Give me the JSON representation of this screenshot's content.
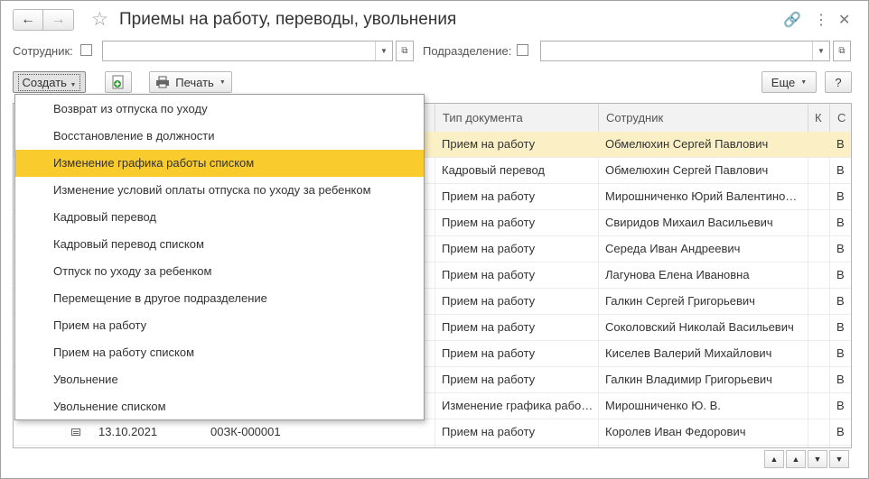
{
  "window": {
    "title": "Приемы на работу, переводы, увольнения",
    "back_icon": "arrow-left-icon",
    "forward_icon": "arrow-right-icon",
    "favorite_icon": "star-icon",
    "link_icon": "link-icon",
    "more_icon": "kebab-icon",
    "close_icon": "close-icon"
  },
  "filters": {
    "employee_label": "Сотрудник:",
    "employee_value": "",
    "department_label": "Подразделение:",
    "department_value": ""
  },
  "toolbar": {
    "create_label": "Создать",
    "print_label": "Печать",
    "more_label": "Еще",
    "help_label": "?"
  },
  "table": {
    "columns": [
      "Тип документа",
      "Сотрудник",
      "К",
      "С"
    ],
    "rows": [
      {
        "date": "",
        "number": "",
        "type": "Прием на работу",
        "employee": "Обмелюхин Сергей Павлович",
        "c": "В",
        "selected": true
      },
      {
        "date": "",
        "number": "",
        "type": "Кадровый перевод",
        "employee": "Обмелюхин Сергей Павлович",
        "c": "В"
      },
      {
        "date": "",
        "number": "",
        "type": "Прием на работу",
        "employee": "Мирошниченко Юрий Валентино…",
        "c": "В"
      },
      {
        "date": "",
        "number": "",
        "type": "Прием на работу",
        "employee": "Свиридов Михаил Васильевич",
        "c": "В"
      },
      {
        "date": "",
        "number": "",
        "type": "Прием на работу",
        "employee": "Середа Иван Андреевич",
        "c": "В"
      },
      {
        "date": "",
        "number": "",
        "type": "Прием на работу",
        "employee": "Лагунова Елена Ивановна",
        "c": "В"
      },
      {
        "date": "",
        "number": "",
        "type": "Прием на работу",
        "employee": "Галкин Сергей Григорьевич",
        "c": "В"
      },
      {
        "date": "",
        "number": "",
        "type": "Прием на работу",
        "employee": "Соколовский Николай Васильевич",
        "c": "В"
      },
      {
        "date": "",
        "number": "",
        "type": "Прием на работу",
        "employee": "Киселев Валерий Михайлович",
        "c": "В"
      },
      {
        "date": "",
        "number": "",
        "type": "Прием на работу",
        "employee": "Галкин Владимир Григорьевич",
        "c": "В"
      },
      {
        "date": "",
        "number": "",
        "type": "Изменение графика рабо…",
        "employee": "Мирошниченко Ю. В.",
        "c": "В"
      },
      {
        "date": "13.10.2021",
        "number": "00ЗК-000001",
        "type": "Прием на работу",
        "employee": "Королев Иван Федорович",
        "c": "В"
      }
    ]
  },
  "create_menu": {
    "items": [
      "Возврат из отпуска по уходу",
      "Восстановление в должности",
      "Изменение графика работы списком",
      "Изменение условий оплаты отпуска по уходу за ребенком",
      "Кадровый перевод",
      "Кадровый перевод списком",
      "Отпуск по уходу за ребенком",
      "Перемещение в другое подразделение",
      "Прием на работу",
      "Прием на работу списком",
      "Увольнение",
      "Увольнение списком"
    ],
    "highlighted_index": 2,
    "highlight_color": "#f9cb2c"
  },
  "nav_arrows": [
    "first-icon",
    "up-icon",
    "down-icon",
    "last-icon"
  ]
}
